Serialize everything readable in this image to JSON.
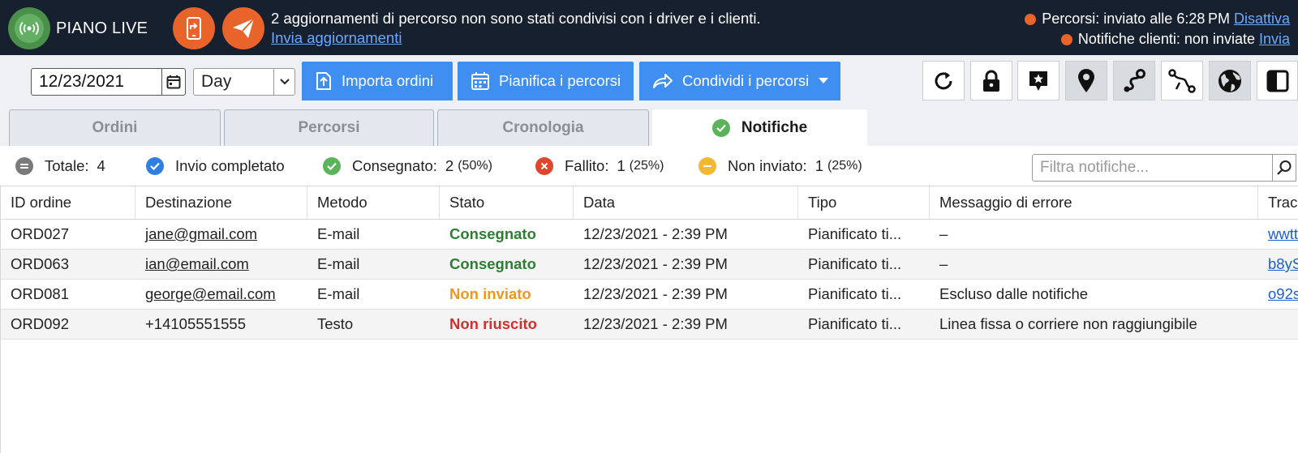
{
  "app": {
    "brand": "PIANO LIVE"
  },
  "banner": {
    "message": "2 aggiornamenti di percorso non sono stati condivisi con i driver e i clienti.",
    "link": "Invia aggiornamenti"
  },
  "status": {
    "routes_text": "Percorsi: inviato alle 6:28 PM",
    "routes_link": "Disattiva",
    "notif_text": "Notifiche clienti: non inviate",
    "notif_link": "Invia"
  },
  "toolbar": {
    "date_value": "12/23/2021",
    "view_select": "Day",
    "import_label": "Importa ordini",
    "plan_label": "Pianifica i percorsi",
    "share_label": "Condividi i percorsi",
    "icons": [
      "refresh-icon",
      "lock-icon",
      "map-pin-star-icon",
      "location-pin-icon",
      "route-icon",
      "route-share-icon",
      "globe-icon",
      "sidebar-toggle-icon"
    ]
  },
  "tabs": [
    {
      "label": "Ordini"
    },
    {
      "label": "Percorsi"
    },
    {
      "label": "Cronologia"
    },
    {
      "label": "Notifiche",
      "active": true
    }
  ],
  "summary": {
    "total_label": "Totale:",
    "total_value": "4",
    "complete_label": "Invio completato",
    "delivered_label": "Consegnato:",
    "delivered_value": "2",
    "delivered_pct": "(50%)",
    "failed_label": "Fallito:",
    "failed_value": "1",
    "failed_pct": "(25%)",
    "unsent_label": "Non inviato:",
    "unsent_value": "1",
    "unsent_pct": "(25%)",
    "filter_placeholder": "Filtra notifiche...",
    "colors": {
      "total": "#7a7a7a",
      "complete": "#2f7fe0",
      "delivered": "#5bb35a",
      "failed": "#e0462b",
      "unsent": "#f2b833"
    }
  },
  "table": {
    "headers": [
      "ID ordine",
      "Destinazione",
      "Metodo",
      "Stato",
      "Data",
      "Tipo",
      "Messaggio di errore",
      "Trac"
    ],
    "rows": [
      {
        "id": "ORD027",
        "dest": "jane@gmail.com",
        "method": "E-mail",
        "state": "Consegnato",
        "date": "12/23/2021 - 2:39 PM",
        "type": "Pianificato ti...",
        "error": "–",
        "track": "wwtt"
      },
      {
        "id": "ORD063",
        "dest": "ian@email.com",
        "method": "E-mail",
        "state": "Consegnato",
        "date": "12/23/2021 - 2:39 PM",
        "type": "Pianificato ti...",
        "error": "–",
        "track": "b8yS"
      },
      {
        "id": "ORD081",
        "dest": "george@email.com",
        "method": "E-mail",
        "state": "Non inviato",
        "date": "12/23/2021 - 2:39 PM",
        "type": "Pianificato ti...",
        "error": "Escluso dalle notifiche",
        "track": "o92s"
      },
      {
        "id": "ORD092",
        "dest": "+14105551555",
        "method": "Testo",
        "state": "Non riuscito",
        "date": "12/23/2021 - 2:39 PM",
        "type": "Pianificato ti...",
        "error": "Linea fissa o corriere non raggiungibile",
        "track": ""
      }
    ],
    "state_colors": {
      "Consegnato": "#2e7d32",
      "Non inviato": "#f0951d",
      "Non riuscito": "#d0302f"
    }
  }
}
